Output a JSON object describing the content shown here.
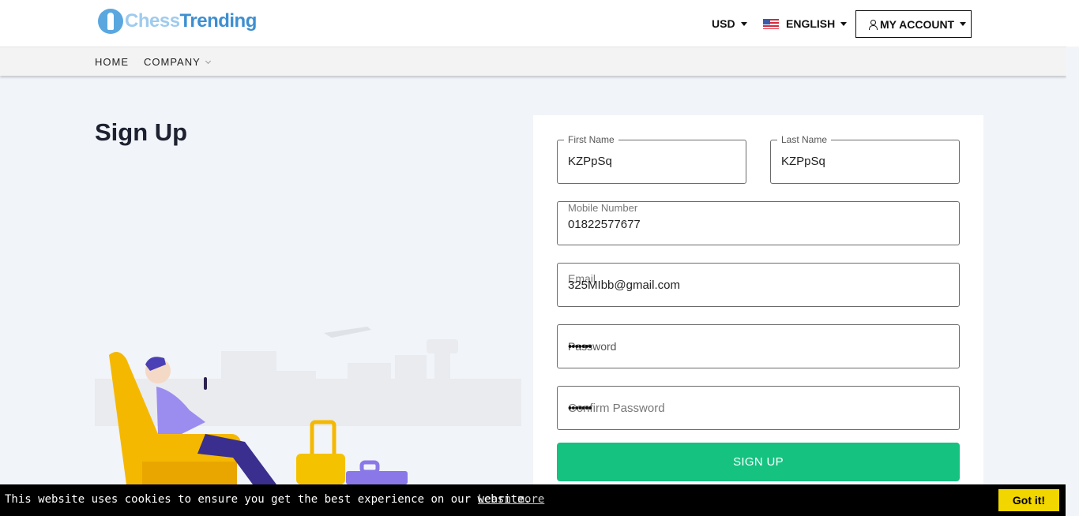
{
  "header": {
    "logo_part1": "Chess",
    "logo_part2": "Trending",
    "currency": "USD",
    "language": "ENGLISH",
    "account": "MY ACCOUNT"
  },
  "nav": {
    "home": "HOME",
    "company": "COMPANY"
  },
  "page": {
    "title": "Sign Up"
  },
  "form": {
    "first_name": {
      "label": "First Name",
      "value": "KZPpSq"
    },
    "last_name": {
      "label": "Last Name",
      "value": "KZPpSq"
    },
    "mobile": {
      "label": "Mobile Number",
      "value": "01822577677"
    },
    "email": {
      "label": "Email",
      "value": "325MIbb@gmail.com"
    },
    "password": {
      "label": "Password",
      "value": "•••••••"
    },
    "confirm_password": {
      "label": "Confirm Password",
      "value": "•••••••"
    },
    "submit": "SIGN UP"
  },
  "cookie": {
    "message": "This website uses cookies to ensure you get the best experience on our website.",
    "link": "Learn more",
    "button": "Got it!"
  },
  "colors": {
    "accent_green": "#15c280",
    "cookie_button": "#f1d600",
    "background": "#f1f4f8"
  }
}
